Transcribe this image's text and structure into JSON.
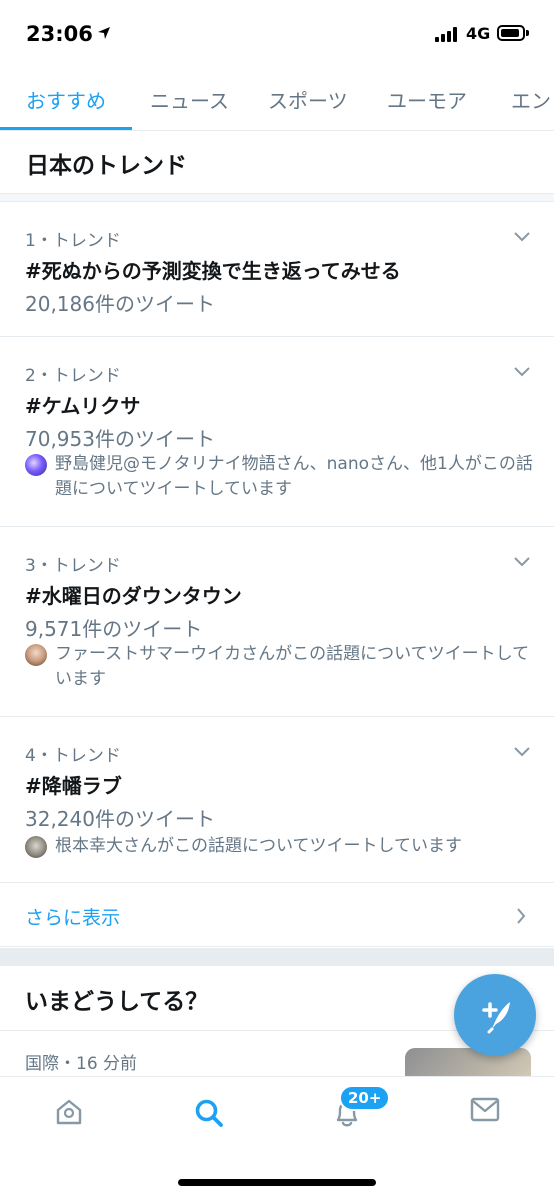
{
  "status_bar": {
    "time": "23:06",
    "network": "4G"
  },
  "tabs": [
    {
      "label": "おすすめ",
      "active": true
    },
    {
      "label": "ニュース"
    },
    {
      "label": "スポーツ"
    },
    {
      "label": "ユーモア"
    },
    {
      "label": "エン"
    }
  ],
  "trends_section": {
    "title": "日本のトレンド"
  },
  "trends": [
    {
      "rank": "1・トレンド",
      "name": "#死ぬからの予測変換で生き返ってみせる",
      "count": "20,186件のツイート",
      "context": ""
    },
    {
      "rank": "2・トレンド",
      "name": "#ケムリクサ",
      "count": "70,953件のツイート",
      "context": "野島健児@モノタリナイ物語さん、nanoさん、他1人がこの話題についてツイートしています"
    },
    {
      "rank": "3・トレンド",
      "name": "#水曜日のダウンタウン",
      "count": "9,571件のツイート",
      "context": "ファーストサマーウイカさんがこの話題についてツイートしています"
    },
    {
      "rank": "4・トレンド",
      "name": "#降幡ラブ",
      "count": "32,240件のツイート",
      "context": "根本幸大さんがこの話題についてツイートしています"
    }
  ],
  "show_more": {
    "label": "さらに表示"
  },
  "now_section": {
    "title": "いまどうしてる？"
  },
  "news": {
    "meta": "国際・16 分前"
  },
  "bottom_nav": {
    "notifications_badge": "20+"
  },
  "colors": {
    "accent": "#1da1f2",
    "secondary_text": "#657786",
    "divider": "#e6ecf0"
  }
}
